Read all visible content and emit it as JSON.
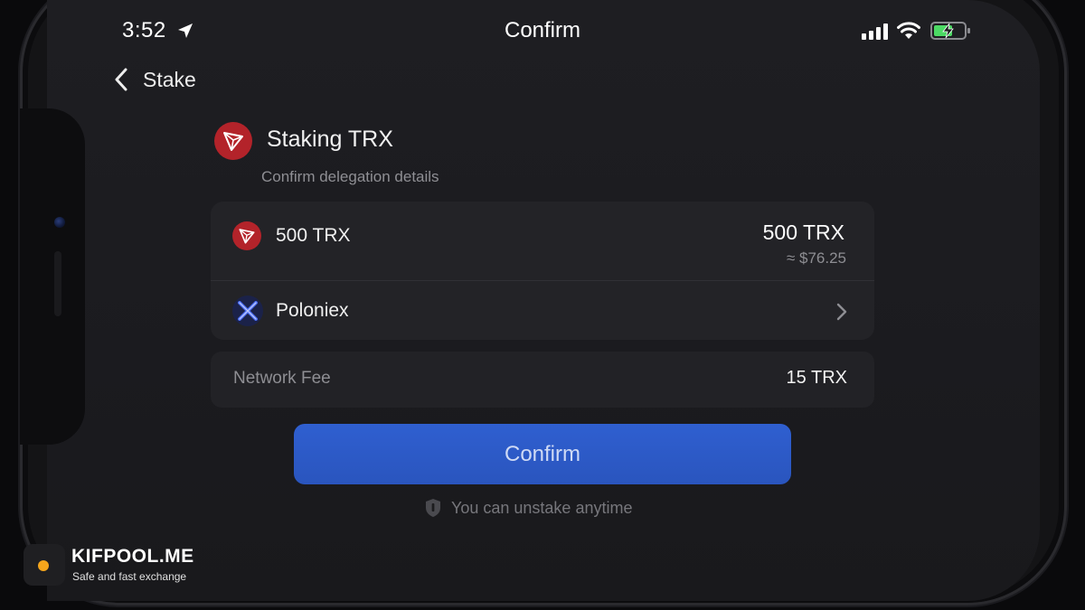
{
  "status_bar": {
    "time": "3:52",
    "title": "Confirm"
  },
  "nav": {
    "back_label": "Stake"
  },
  "header": {
    "title": "Staking TRX",
    "subtitle": "Confirm delegation details"
  },
  "details": {
    "amount_label": "500 TRX",
    "amount_value": "500 TRX",
    "amount_usd": "≈ $76.25",
    "validator_label": "Poloniex"
  },
  "fee": {
    "label": "Network Fee",
    "value": "15 TRX"
  },
  "actions": {
    "confirm_label": "Confirm",
    "note": "You can unstake anytime"
  },
  "watermark": {
    "title": "KIFPOOL.ME",
    "subtitle": "Safe and fast exchange"
  },
  "colors": {
    "accent": "#2f5fd0",
    "tron_red": "#b3232a",
    "watermark_orange": "#f4a51c"
  }
}
